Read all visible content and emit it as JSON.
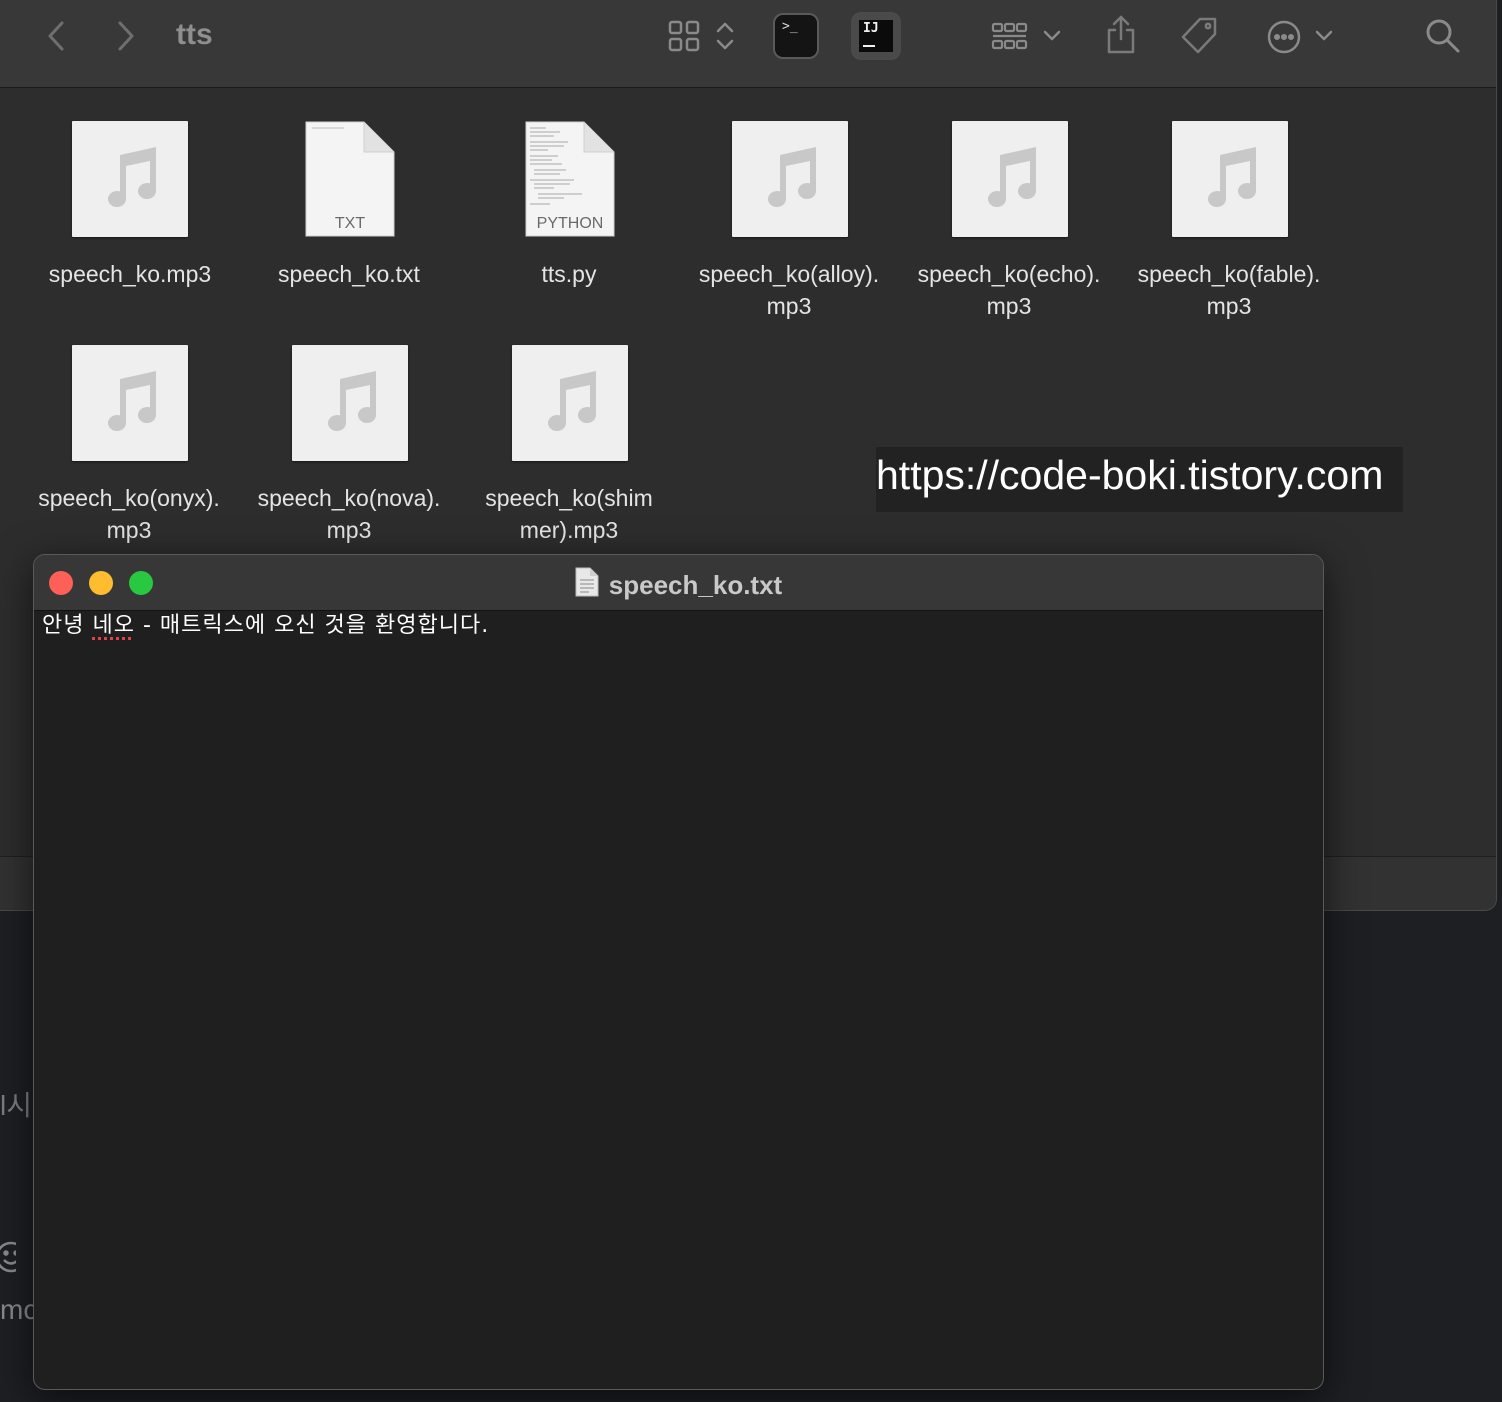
{
  "finder": {
    "title": "tts",
    "toolbar_icons": [
      "back-icon",
      "forward-icon",
      "grid-view-icon",
      "sort-chevrons-icon",
      "terminal-app-icon",
      "intellij-app-icon",
      "group-icon",
      "share-icon",
      "tag-icon",
      "more-icon",
      "search-icon"
    ],
    "terminal_label": ">_",
    "intellij_label": "IJ",
    "files": [
      {
        "name": "speech_ko.mp3",
        "type": "audio"
      },
      {
        "name": "speech_ko.txt",
        "type": "doc",
        "badge": "TXT"
      },
      {
        "name": "tts.py",
        "type": "doc",
        "badge": "PYTHON"
      },
      {
        "name": "speech_ko(alloy).\nmp3",
        "type": "audio"
      },
      {
        "name": "speech_ko(echo).\nmp3",
        "type": "audio"
      },
      {
        "name": "speech_ko(fable).\nmp3",
        "type": "audio"
      },
      {
        "name": "speech_ko(onyx).\nmp3",
        "type": "audio"
      },
      {
        "name": "speech_ko(nova).\nmp3",
        "type": "audio"
      },
      {
        "name": "speech_ko(shim\nmer).mp3",
        "type": "audio"
      }
    ]
  },
  "watermark": "https://code-boki.tistory.com",
  "background_fragments": {
    "text_a": "l시",
    "text_b": "mc"
  },
  "editor": {
    "title": "speech_ko.txt",
    "content_before": "안녕 ",
    "content_misspelled": "네오",
    "content_after": " - 매트릭스에 오신 것을 환영합니다."
  },
  "colors": {
    "close": "#fe5f57",
    "minimize": "#febc2e",
    "maximize": "#28c840"
  }
}
